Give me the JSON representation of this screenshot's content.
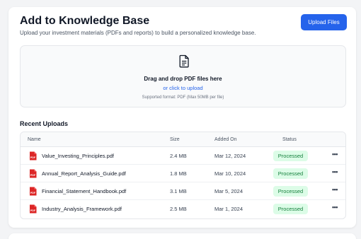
{
  "header": {
    "title": "Add to Knowledge Base",
    "subtitle": "Upload your investment materials (PDFs and reports) to build a personalized knowledge base.",
    "upload_label": "Upload Files"
  },
  "dropzone": {
    "title": "Drag and drop PDF files here",
    "link": "or click to upload",
    "note": "Supported format: PDF (Max 50MB per file)",
    "icon": "document-icon"
  },
  "recent": {
    "title": "Recent Uploads",
    "columns": {
      "name": "Name",
      "size": "Size",
      "added": "Added On",
      "status": "Status"
    },
    "rows": [
      {
        "name": "Value_Investing_Principles.pdf",
        "size": "2.4 MB",
        "added": "Mar 12, 2024",
        "status": "Processed"
      },
      {
        "name": "Annual_Report_Analysis_Guide.pdf",
        "size": "1.8 MB",
        "added": "Mar 10, 2024",
        "status": "Processed"
      },
      {
        "name": "Financial_Statement_Handbook.pdf",
        "size": "3.1 MB",
        "added": "Mar 5, 2024",
        "status": "Processed"
      },
      {
        "name": "Industry_Analysis_Framework.pdf",
        "size": "2.5 MB",
        "added": "Mar 1, 2024",
        "status": "Processed"
      }
    ],
    "more_label": "•••"
  },
  "colors": {
    "accent": "#2563eb",
    "pdf_red": "#dc2626",
    "processed_bg": "#dcfce7",
    "processed_text": "#15803d"
  }
}
